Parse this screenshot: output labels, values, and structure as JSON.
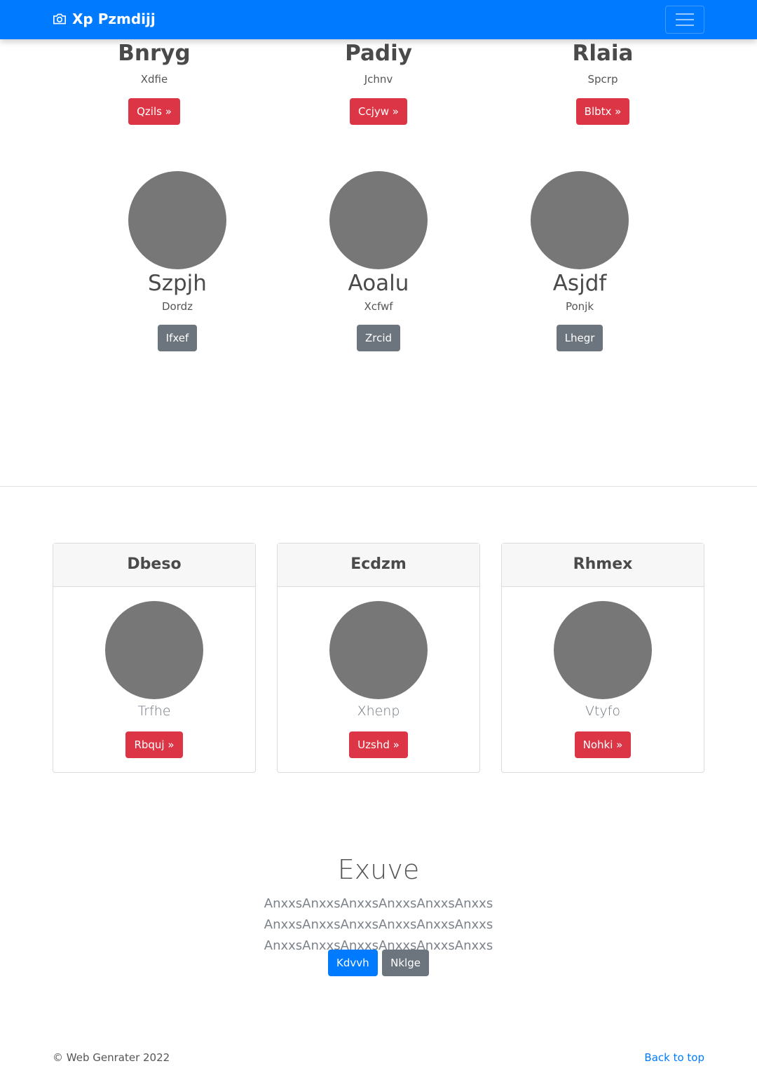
{
  "navbar": {
    "brand": "Xp Pzmdijj",
    "brand_icon": "camera-icon",
    "toggle_icon": "hamburger-icon"
  },
  "row1": [
    {
      "name": "Bnryg",
      "sub": "Xdfie",
      "button": "Qzils »"
    },
    {
      "name": "Padiy",
      "sub": "Jchnv",
      "button": "Ccjyw »"
    },
    {
      "name": "Rlaia",
      "sub": "Spcrp",
      "button": "Blbtx »"
    }
  ],
  "row2": [
    {
      "name": "Szpjh",
      "sub": "Dordz",
      "button": "Ifxef"
    },
    {
      "name": "Aoalu",
      "sub": "Xcfwf",
      "button": "Zrcid"
    },
    {
      "name": "Asjdf",
      "sub": "Ponjk",
      "button": "Lhegr"
    }
  ],
  "cards": [
    {
      "title": "Dbeso",
      "sub": "Trfhe",
      "button": "Rbquj »"
    },
    {
      "title": "Ecdzm",
      "sub": "Xhenp",
      "button": "Uzshd »"
    },
    {
      "title": "Rhmex",
      "sub": "Vtyfo",
      "button": "Nohki »"
    }
  ],
  "hero": {
    "title": "Exuve",
    "text": "AnxxsAnxxsAnxxsAnxxsAnxxsAnxxs AnxxsAnxxsAnxxsAnxxsAnxxsAnxxs AnxxsAnxxsAnxxsAnxxsAnxxsAnxxs",
    "primary_button": "Kdvvh",
    "secondary_button": "Nklge"
  },
  "footer": {
    "copyright": "© Web Genrater 2022",
    "back_to_top": "Back to top"
  },
  "colors": {
    "primary": "#007bff",
    "danger": "#dc3545",
    "secondary": "#6c757d",
    "placeholder": "#777777"
  }
}
